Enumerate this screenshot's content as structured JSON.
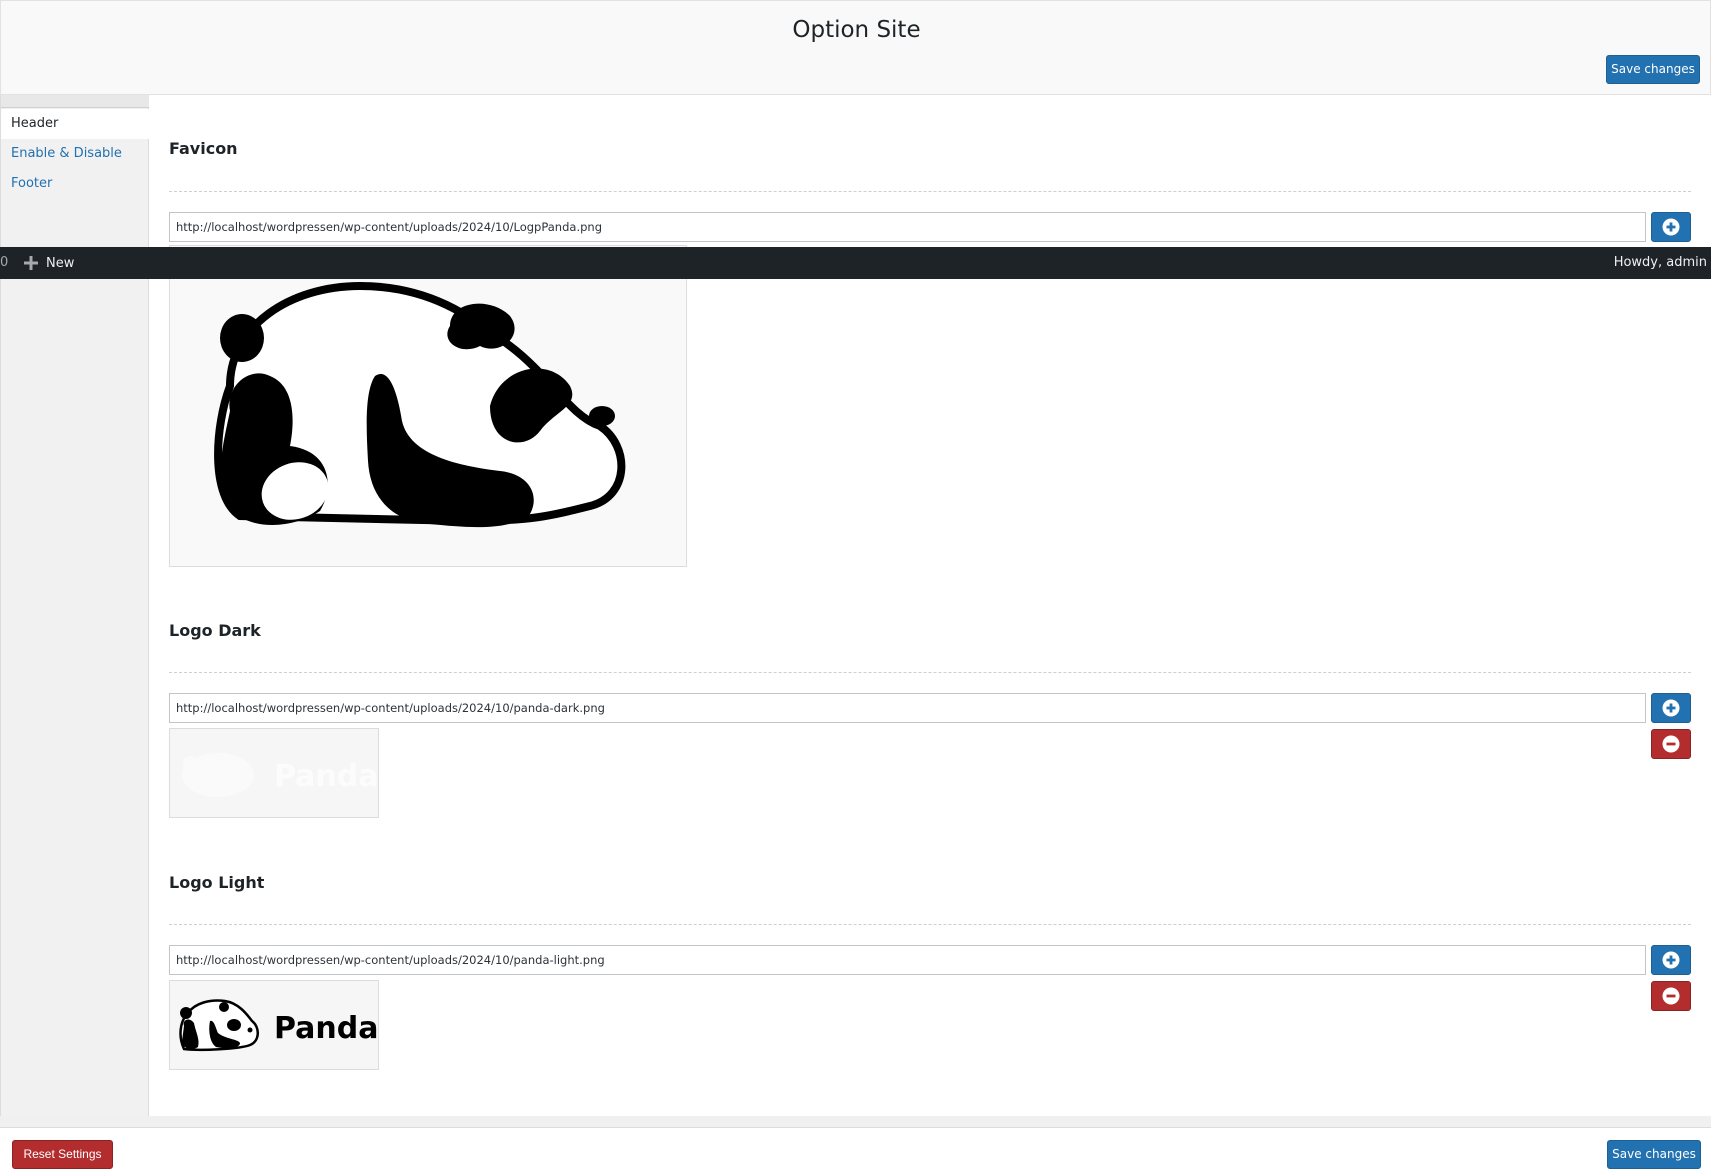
{
  "header": {
    "title": "Option Site",
    "save_label": "Save changes"
  },
  "sidebar": {
    "items": [
      {
        "label": "Header"
      },
      {
        "label": "Enable & Disable"
      },
      {
        "label": "Footer"
      }
    ]
  },
  "admin_bar": {
    "counter": "0",
    "new_label": "New",
    "greeting": "Howdy, admin"
  },
  "sections": {
    "favicon": {
      "title": "Favicon",
      "url": "http://localhost/wordpressen/wp-content/uploads/2024/10/LogpPanda.png"
    },
    "logo_dark": {
      "title": "Logo Dark",
      "url": "http://localhost/wordpressen/wp-content/uploads/2024/10/panda-dark.png",
      "preview_text": "Panda"
    },
    "logo_light": {
      "title": "Logo Light",
      "url": "http://localhost/wordpressen/wp-content/uploads/2024/10/panda-light.png",
      "preview_text": "Panda"
    }
  },
  "footer": {
    "reset_label": "Reset Settings",
    "save_label": "Save changes"
  },
  "colors": {
    "primary": "#2271b1",
    "danger": "#b32d2e",
    "admin_bar": "#1d2327"
  }
}
